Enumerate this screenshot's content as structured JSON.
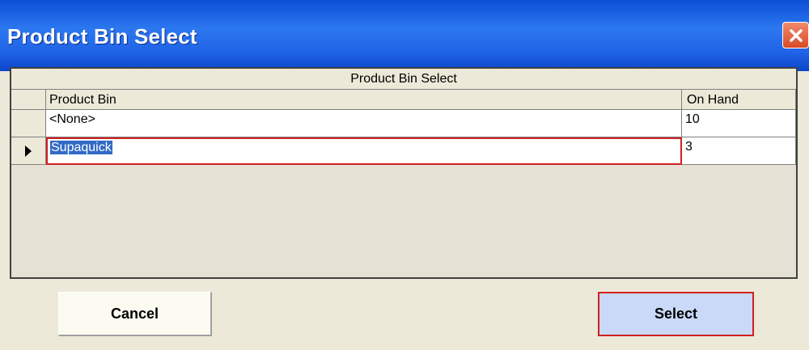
{
  "window": {
    "title": "Product Bin Select"
  },
  "grid": {
    "caption": "Product Bin Select",
    "columns": [
      "Product Bin",
      "On Hand"
    ],
    "rows": [
      {
        "bin": "<None>",
        "on_hand": "10"
      },
      {
        "bin": "Supaquick",
        "on_hand": "3"
      }
    ],
    "selected_row": 1
  },
  "buttons": {
    "cancel": "Cancel",
    "select": "Select"
  },
  "colors": {
    "titlebar": "#0a4fd6",
    "selection": "#316ac5",
    "focus_border": "#d02020",
    "select_button": "#c9d9f7"
  }
}
